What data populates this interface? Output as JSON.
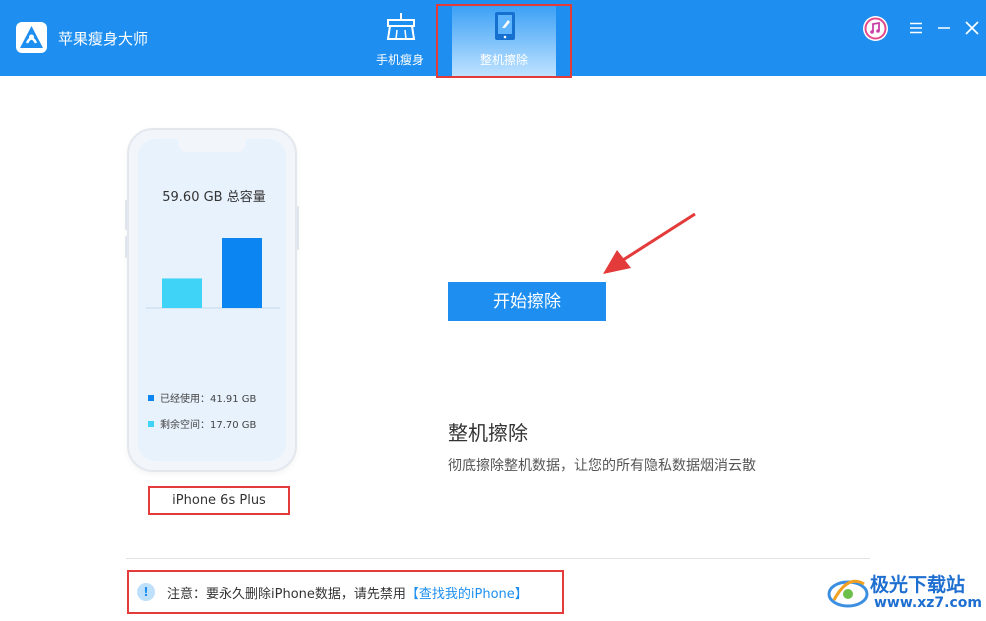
{
  "app": {
    "title": "苹果瘦身大师"
  },
  "tabs": [
    {
      "label": "手机瘦身",
      "icon": "broom-icon"
    },
    {
      "label": "整机擦除",
      "icon": "phone-erase-icon"
    }
  ],
  "device": {
    "capacity": "59.60 GB 总容量",
    "used_label": "已经使用：41.91 GB",
    "free_label": "剩余空间：17.70 GB",
    "used_gb": 41.91,
    "free_gb": 17.7,
    "model": "iPhone 6s Plus"
  },
  "main": {
    "start_button": "开始擦除",
    "title": "整机擦除",
    "description": "彻底擦除整机数据，让您的所有隐私数据烟消云散"
  },
  "notice": {
    "text": "注意：要永久删除iPhone数据，请先禁用",
    "link": "【查找我的iPhone】"
  },
  "watermark": {
    "title": "极光下载站",
    "url": "www.xz7.com"
  },
  "colors": {
    "primary": "#1e8ff0",
    "used": "#0a85f2",
    "free": "#3fd3f7",
    "highlight": "#e33a3a"
  }
}
